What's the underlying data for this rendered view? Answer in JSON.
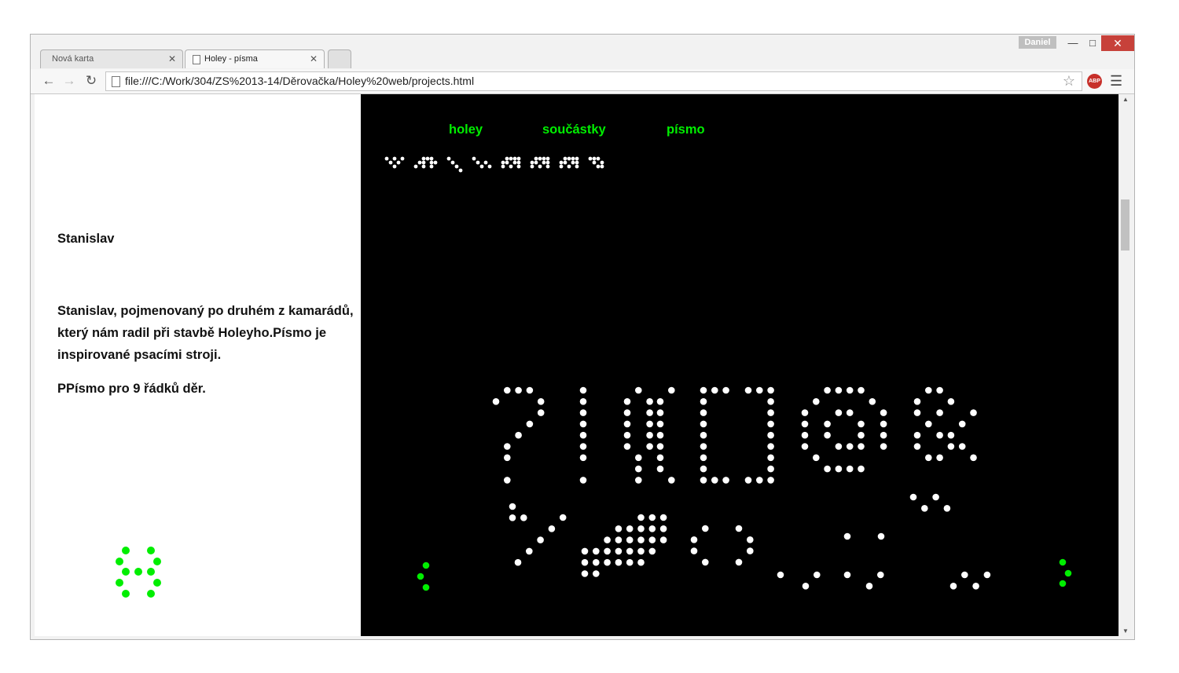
{
  "window": {
    "user": "Daniel"
  },
  "tabs": [
    {
      "label": "Nová karta"
    },
    {
      "label": "Holey - písma"
    }
  ],
  "address": {
    "url": "file:///C:/Work/304/ZS%2013-14/Děrovačka/Holey%20web/projects.html"
  },
  "toolbar": {
    "abp_label": "ABP"
  },
  "nav": {
    "items": [
      {
        "label": "holey"
      },
      {
        "label": "součástky"
      },
      {
        "label": "písmo"
      }
    ]
  },
  "content": {
    "title": "Stanislav",
    "description": "Stanislav, pojmenovaný po druhém z kamarádů, který nám radil při stavbě Holeyho.Písmo je inspirované psacími stroji.",
    "note": "PPísmo pro 9 řádků děr."
  },
  "colors": {
    "accent": "#00ee00",
    "dots": "#ffffff",
    "canvas": "#000000"
  }
}
